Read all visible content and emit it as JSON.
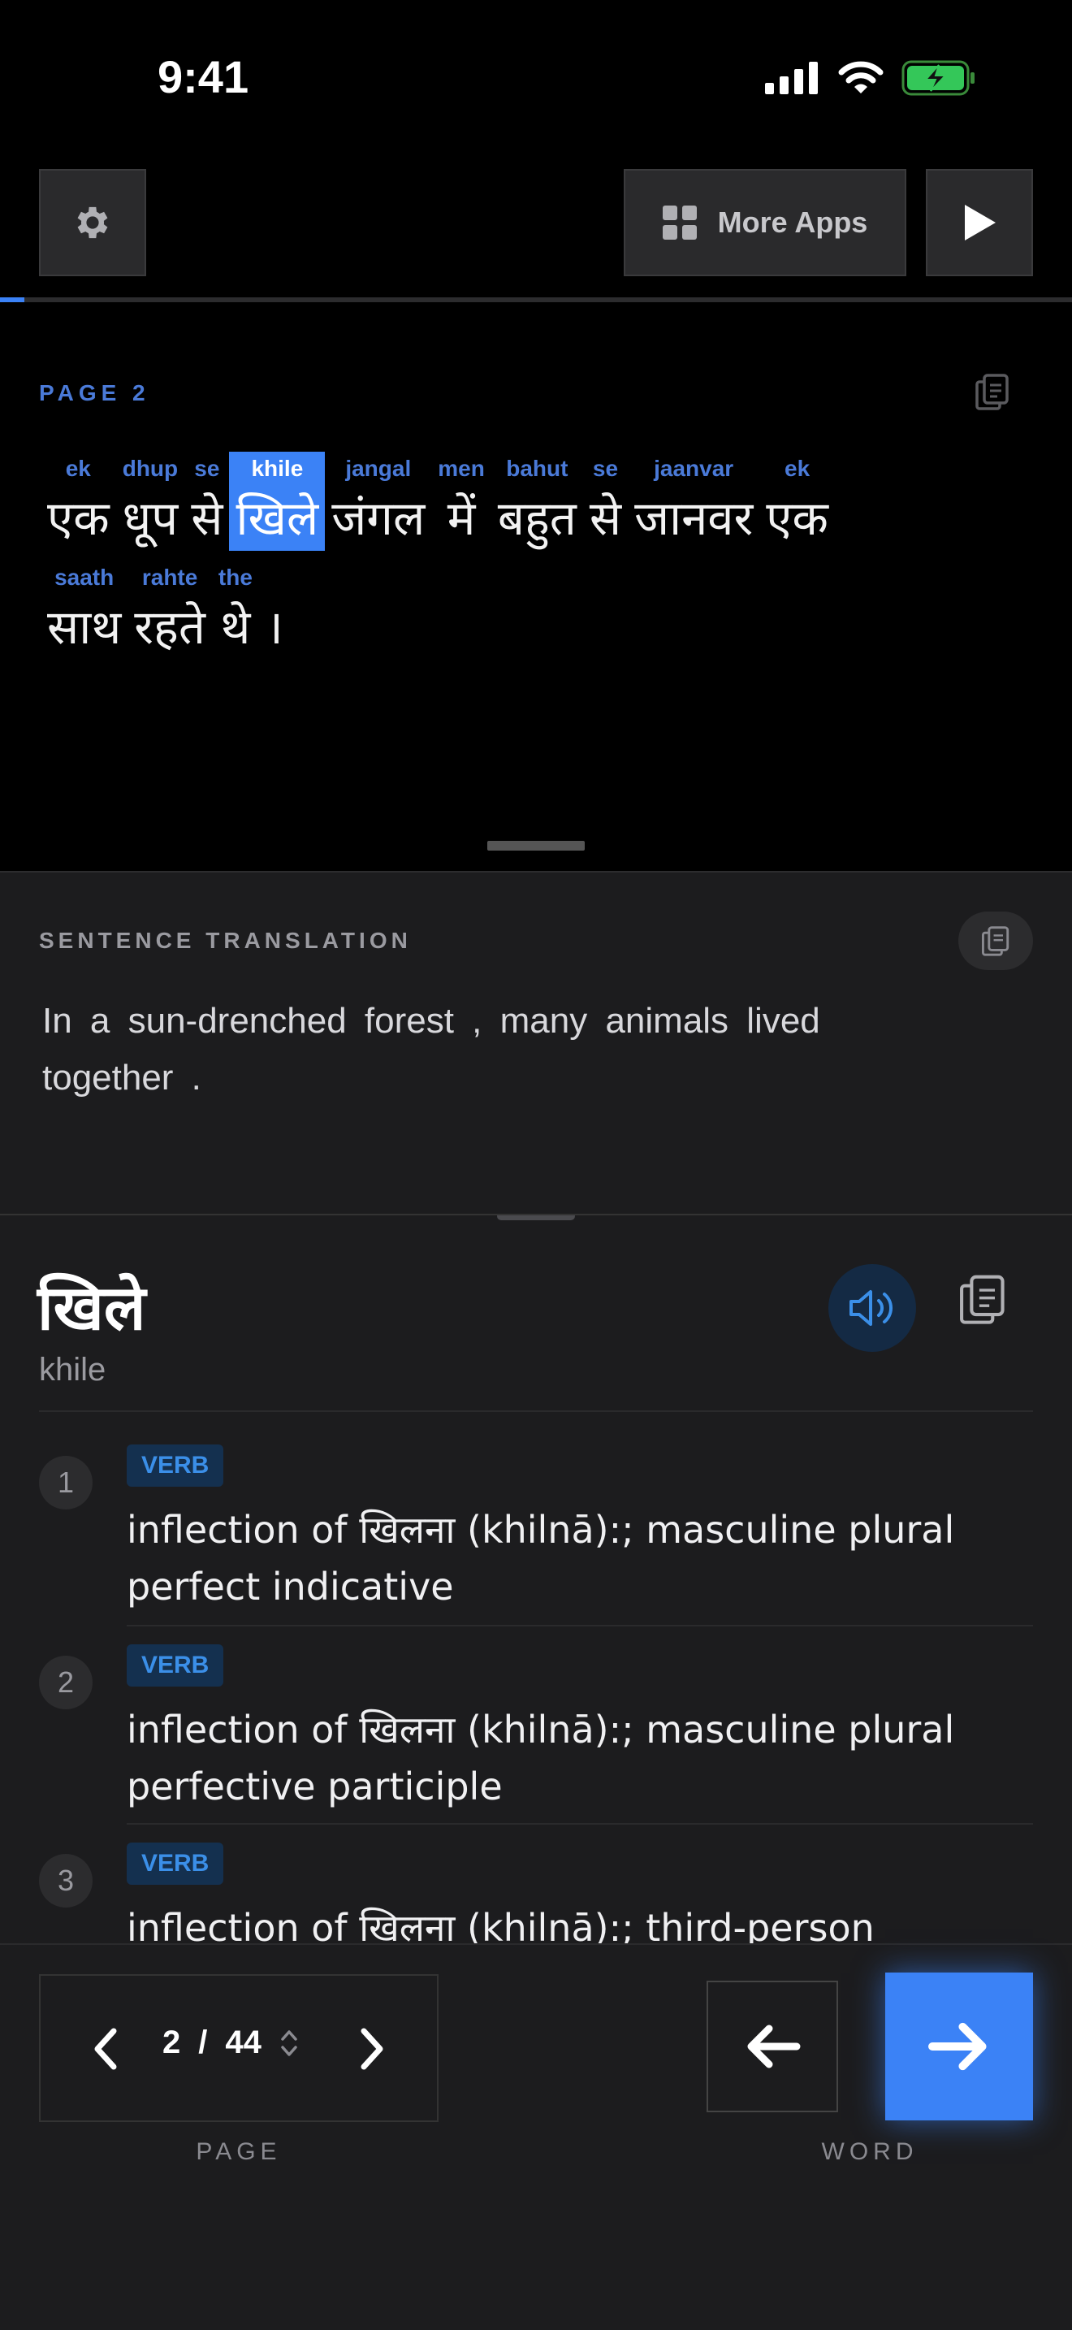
{
  "status": {
    "time": "9:41"
  },
  "toolbar": {
    "more_apps_label": "More Apps"
  },
  "reading_progress": 0.023,
  "reader": {
    "page_label": "PAGE 2",
    "lines": [
      [
        {
          "tr": "ek",
          "hi": "एक"
        },
        {
          "tr": "dhup",
          "hi": "धूप"
        },
        {
          "tr": "se",
          "hi": "से"
        },
        {
          "tr": "khile",
          "hi": "खिले",
          "selected": true
        },
        {
          "tr": "jangal",
          "hi": "जंगल"
        },
        {
          "tr": "men",
          "hi": "में"
        },
        {
          "tr": "bahut",
          "hi": "बहुत"
        },
        {
          "tr": "se",
          "hi": "से"
        },
        {
          "tr": "jaanvar",
          "hi": "जानवर"
        },
        {
          "tr": "ek",
          "hi": "एक"
        }
      ],
      [
        {
          "tr": "saath",
          "hi": "साथ"
        },
        {
          "tr": "rahte",
          "hi": "रहते"
        },
        {
          "tr": "the",
          "hi": "थे"
        },
        {
          "tr": "",
          "hi": "।"
        }
      ]
    ]
  },
  "translation": {
    "heading": "SENTENCE TRANSLATION",
    "text": "In a sun-drenched forest , many animals lived together ."
  },
  "dictionary": {
    "word": "खिले",
    "transliteration": "khile",
    "senses": [
      {
        "num": "1",
        "pos": "VERB",
        "gloss": "inflection of खिलना (khilnā):; masculine plural perfect indicative"
      },
      {
        "num": "2",
        "pos": "VERB",
        "gloss": "inflection of खिलना (khilnā):; masculine plural perfective participle"
      },
      {
        "num": "3",
        "pos": "VERB",
        "gloss": "inflection of खिलना (khilnā):; third-person singular"
      }
    ]
  },
  "pager": {
    "current": "2",
    "separator": "/",
    "total": "44",
    "label": "PAGE"
  },
  "word_nav": {
    "label": "WORD"
  },
  "colors": {
    "accent": "#3b82f6",
    "background": "#000000",
    "panel": "#1c1c1e"
  }
}
